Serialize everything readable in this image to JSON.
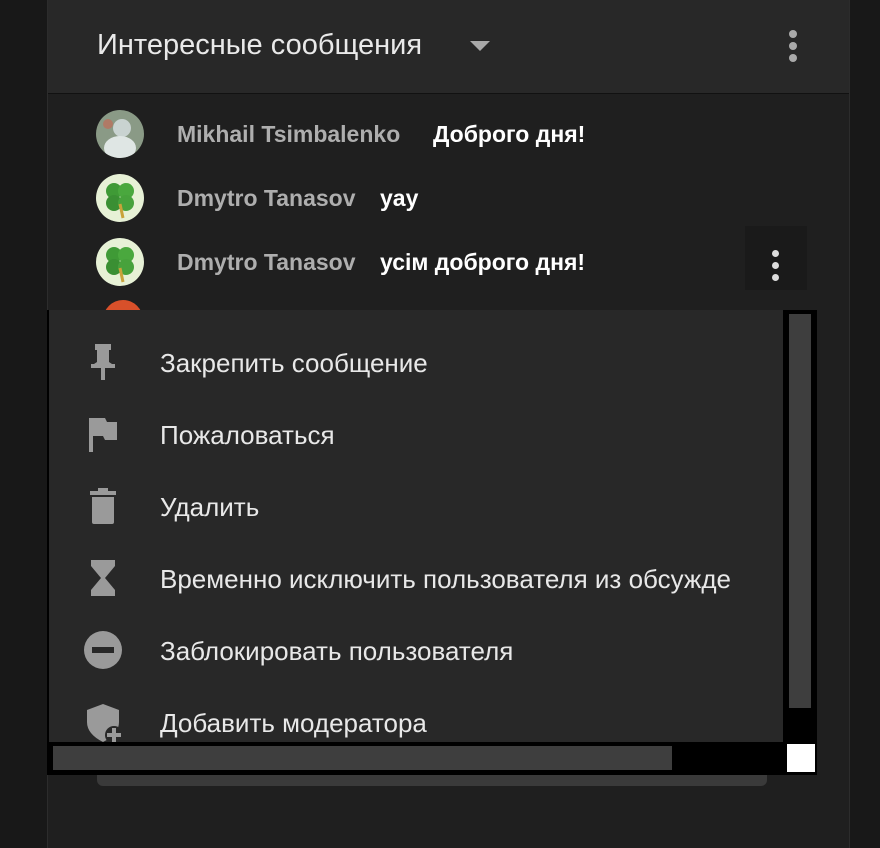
{
  "header": {
    "title": "Интересные сообщения"
  },
  "messages": [
    {
      "author": "Mikhail Tsimbalenko",
      "text": "Доброго дня!"
    },
    {
      "author": "Dmytro Tanasov",
      "text": "yay"
    },
    {
      "author": "Dmytro Tanasov",
      "text": "усім доброго дня!"
    }
  ],
  "context_menu": {
    "items": [
      {
        "label": "Закрепить сообщение",
        "icon": "pin-icon"
      },
      {
        "label": "Пожаловаться",
        "icon": "flag-icon"
      },
      {
        "label": "Удалить",
        "icon": "trash-icon"
      },
      {
        "label": "Временно исключить пользователя из обсужде",
        "icon": "hourglass-icon"
      },
      {
        "label": "Заблокировать пользователя",
        "icon": "block-icon"
      },
      {
        "label": "Добавить модератора",
        "icon": "shield-plus-icon"
      }
    ]
  },
  "colors": {
    "background": "#181818",
    "panel": "#1f1f1f",
    "menu": "#282828",
    "author_text": "#aeaeae",
    "icon_gray": "#9a9a9a"
  }
}
